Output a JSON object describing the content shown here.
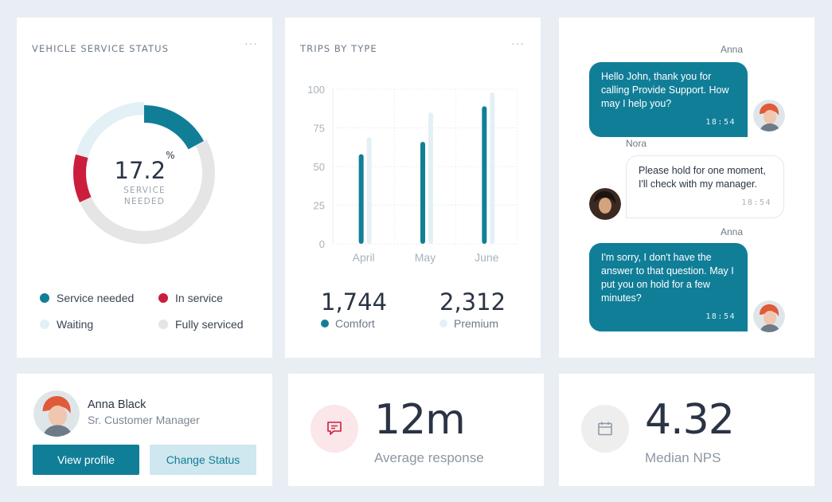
{
  "colors": {
    "accent": "#117e98",
    "danger": "#cb1e3c",
    "light": "#e3f0f5",
    "gray": "#e5e5e5",
    "background": "#e8eef3"
  },
  "vehicle_status": {
    "title": "VEHICLE SERVICE STATUS",
    "more_label": "···",
    "value": "17.2",
    "unit": "%",
    "label_line1": "SERVICE",
    "label_line2": "NEEDED",
    "segments": [
      {
        "name": "Service needed",
        "percent": 17.2,
        "color": "#117e98"
      },
      {
        "name": "Fully serviced",
        "percent": 51,
        "color": "#e5e5e5"
      },
      {
        "name": "In service",
        "percent": 11,
        "color": "#cb1e3c"
      },
      {
        "name": "Waiting",
        "percent": 20.8,
        "color": "#e3f0f5"
      }
    ],
    "legend": [
      {
        "label": "Service needed",
        "color": "#117e98"
      },
      {
        "label": "In service",
        "color": "#cb1e3c"
      },
      {
        "label": "Waiting",
        "color": "#e3f0f5"
      },
      {
        "label": "Fully serviced",
        "color": "#e5e5e5"
      }
    ]
  },
  "trips": {
    "title": "TRIPS BY TYPE",
    "more_label": "···",
    "stats": [
      {
        "value": "1,744",
        "label": "Comfort",
        "color": "#117e98"
      },
      {
        "value": "2,312",
        "label": "Premium",
        "color": "#e3f0f5"
      }
    ]
  },
  "chart_data": {
    "type": "bar",
    "title": "TRIPS BY TYPE",
    "categories": [
      "April",
      "May",
      "June"
    ],
    "series": [
      {
        "name": "Comfort",
        "values": [
          58,
          66,
          89
        ],
        "color": "#117e98"
      },
      {
        "name": "Premium",
        "values": [
          69,
          85,
          98
        ],
        "color": "#e3f0f5"
      }
    ],
    "ylim": [
      0,
      100
    ],
    "yticks": [
      0,
      25,
      50,
      75,
      100
    ],
    "grid": true
  },
  "chat": {
    "messages": [
      {
        "sender": "Anna",
        "text": "Hello John, thank you for calling Provide Support. How may I help you?",
        "time": "18:54",
        "direction": "out"
      },
      {
        "sender": "Nora",
        "text": "Please hold for one moment, I'll check with my manager.",
        "time": "18:54",
        "direction": "in"
      },
      {
        "sender": "Anna",
        "text": "I'm sorry, I don't have the answer to that question. May I put you on hold for a few minutes?",
        "time": "18:54",
        "direction": "out"
      }
    ]
  },
  "profile": {
    "name": "Anna Black",
    "role": "Sr. Customer Manager",
    "view_button": "View profile",
    "status_button": "Change Status"
  },
  "metrics": [
    {
      "value": "12m",
      "label": "Average response",
      "icon": "chat-icon"
    },
    {
      "value": "4.32",
      "label": "Median NPS",
      "icon": "calendar-icon"
    }
  ]
}
